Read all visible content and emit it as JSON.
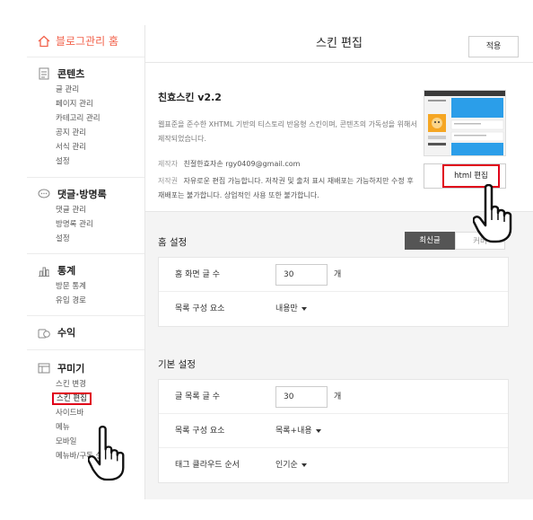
{
  "sidebar": {
    "home": "블로그관리 홈",
    "sections": [
      {
        "icon": "document-icon",
        "title": "콘텐츠",
        "items": [
          "글 관리",
          "페이지 관리",
          "카테고리 관리",
          "공지 관리",
          "서식 관리",
          "설정"
        ]
      },
      {
        "icon": "comment-icon",
        "title": "댓글·방명록",
        "items": [
          "댓글 관리",
          "방명록 관리",
          "설정"
        ]
      },
      {
        "icon": "bar-chart-icon",
        "title": "통계",
        "items": [
          "방문 통계",
          "유입 경로"
        ]
      },
      {
        "icon": "coins-icon",
        "title": "수익",
        "items": []
      },
      {
        "icon": "window-icon",
        "title": "꾸미기",
        "items": [
          "스킨 변경",
          "스킨 편집",
          "사이드바",
          "메뉴",
          "모바일",
          "메뉴바/구독 설정"
        ]
      }
    ],
    "active_item": "스킨 편집"
  },
  "topbar": {
    "title": "스킨 편집",
    "apply_label": "적용"
  },
  "skin": {
    "name": "친효스킨 v2.2",
    "description": "웹표준을 준수한 XHTML 기반의 티스토리 반응형 스킨이며, 콘텐츠의 가독성을 위해서 제작되었습니다.",
    "author_key": "제작자",
    "author_value": "친절한효자손 rgy0409@gmail.com",
    "copyright_key": "저작권",
    "copyright_value": "자유로운 편집 가능합니다. 저작권 및 출처 표시 재배포는 가능하지만 수정 후 재배포는 불가합니다. 상업적인 사용 또한 불가합니다.",
    "html_edit_label": "html 편집"
  },
  "home_settings": {
    "title": "홈 설정",
    "toggle_on": "최신글",
    "toggle_off": "커버",
    "rows": [
      {
        "label": "홈 화면 글 수",
        "value": "30",
        "unit": "개"
      },
      {
        "label": "목록 구성 요소",
        "value": "내용만"
      }
    ]
  },
  "basic_settings": {
    "title": "기본 설정",
    "rows": [
      {
        "label": "글 목록 글 수",
        "value": "30",
        "unit": "개"
      },
      {
        "label": "목록 구성 요소",
        "value": "목록+내용"
      },
      {
        "label": "태그 클라우드 순서",
        "value": "인기순"
      }
    ]
  },
  "colors": {
    "accent": "#f2624b",
    "highlight": "#e0001a"
  }
}
